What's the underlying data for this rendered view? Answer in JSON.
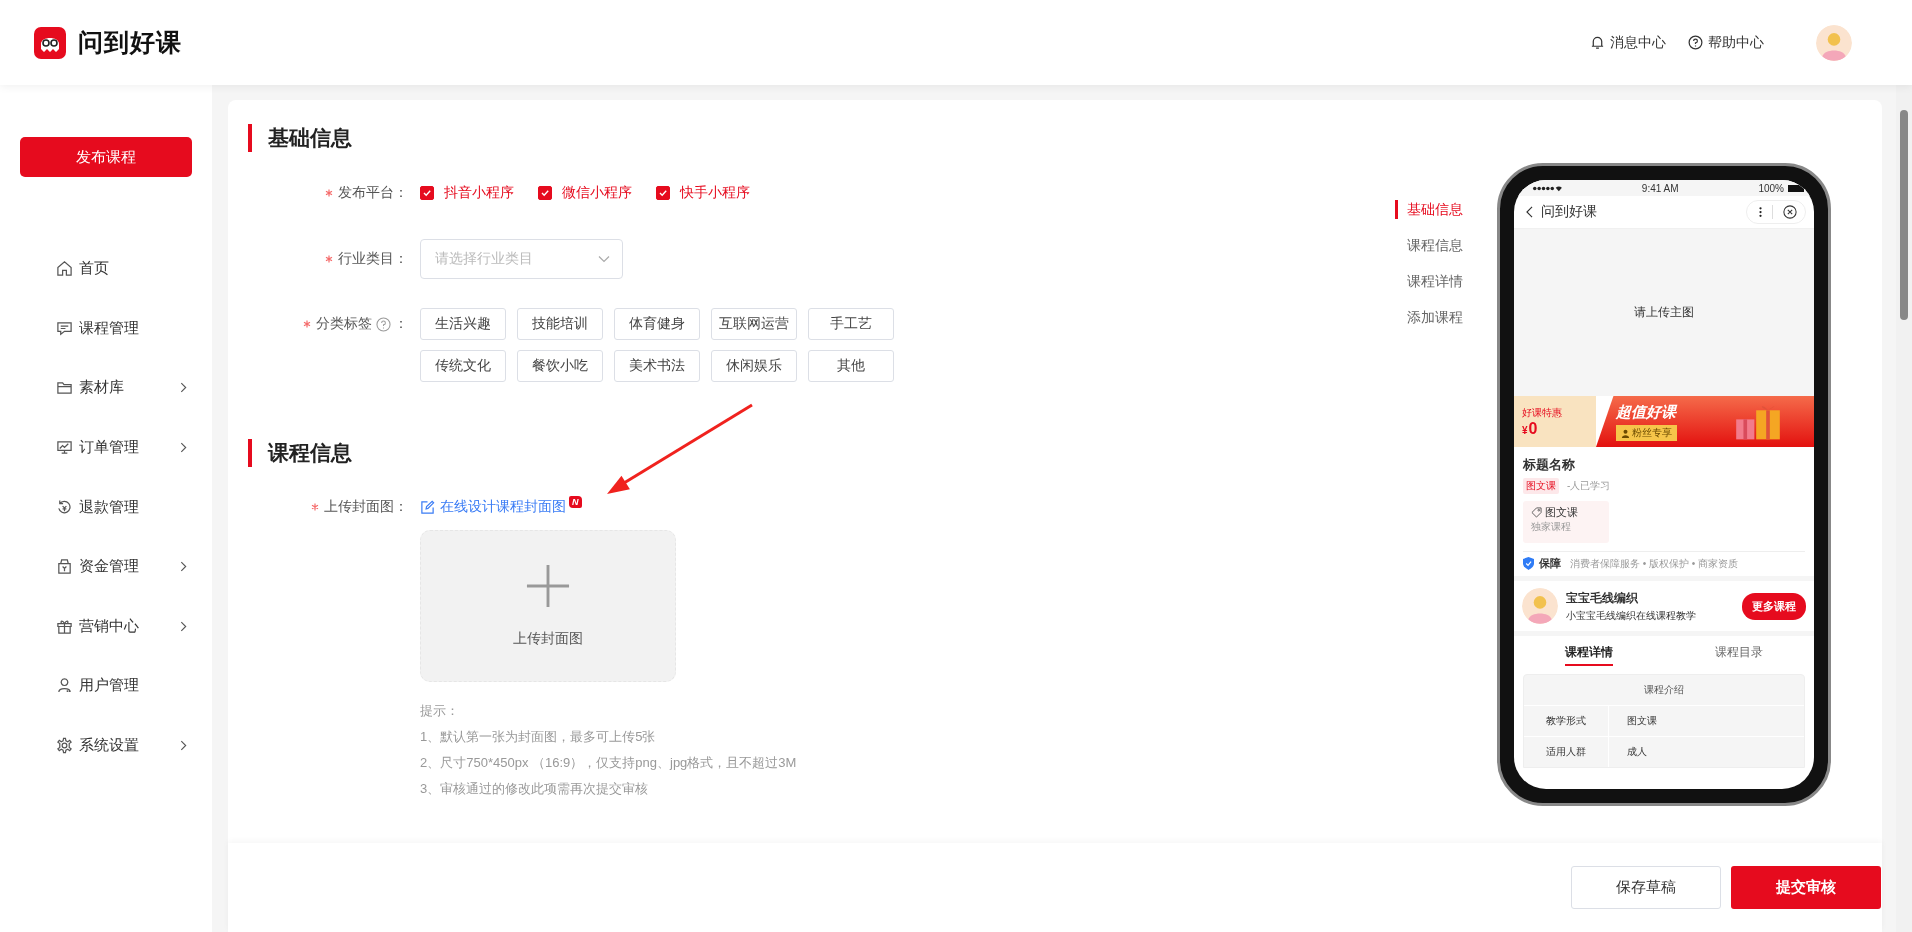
{
  "header": {
    "logo": "问到好课",
    "links": [
      {
        "kind": "bell",
        "label": "消息中心"
      },
      {
        "kind": "help",
        "label": "帮助中心"
      }
    ]
  },
  "sidebar": {
    "publish_button": "发布课程",
    "items": [
      {
        "kind": "home",
        "label": "首页",
        "expandable": false
      },
      {
        "kind": "board",
        "label": "课程管理",
        "expandable": false
      },
      {
        "kind": "folder",
        "label": "素材库",
        "expandable": true
      },
      {
        "kind": "monitor",
        "label": "订单管理",
        "expandable": true
      },
      {
        "kind": "refund",
        "label": "退款管理",
        "expandable": false
      },
      {
        "kind": "wallet",
        "label": "资金管理",
        "expandable": true
      },
      {
        "kind": "gift",
        "label": "营销中心",
        "expandable": true
      },
      {
        "kind": "user",
        "label": "用户管理",
        "expandable": false
      },
      {
        "kind": "gear",
        "label": "系统设置",
        "expandable": true
      }
    ]
  },
  "basic_info": {
    "title": "基础信息",
    "platform": {
      "label": "发布平台：",
      "required": true,
      "options": [
        {
          "label": "抖音小程序",
          "checked": true
        },
        {
          "label": "微信小程序",
          "checked": true
        },
        {
          "label": "快手小程序",
          "checked": true
        }
      ]
    },
    "industry": {
      "label": "行业类目：",
      "required": true,
      "placeholder": "请选择行业类目"
    },
    "tags": {
      "label": "分类标签",
      "colon": "：",
      "required": true,
      "options": [
        {
          "label": "生活兴趣",
          "selected": false
        },
        {
          "label": "技能培训",
          "selected": false
        },
        {
          "label": "体育健身",
          "selected": false
        },
        {
          "label": "互联网运营",
          "selected": false
        },
        {
          "label": "手工艺",
          "selected": false
        },
        {
          "label": "传统文化",
          "selected": false
        },
        {
          "label": "餐饮小吃",
          "selected": false
        },
        {
          "label": "美术书法",
          "selected": false
        },
        {
          "label": "休闲娱乐",
          "selected": false
        },
        {
          "label": "其他",
          "selected": false
        }
      ]
    }
  },
  "course_info": {
    "title": "课程信息",
    "cover": {
      "label": "上传封面图：",
      "required": true,
      "design_link": "在线设计课程封面图",
      "new_badge": "N",
      "upload_label": "上传封面图",
      "hint_title": "提示：",
      "hints": [
        "1、默认第一张为封面图，最多可上传5张",
        "2、尺寸750*450px （16:9），仅支持png、jpg格式，且不超过3M",
        "3、审核通过的修改此项需再次提交审核"
      ]
    }
  },
  "anchor_nav": [
    {
      "label": "基础信息",
      "selected": true
    },
    {
      "label": "课程信息",
      "selected": false
    },
    {
      "label": "课程详情",
      "selected": false
    },
    {
      "label": "添加课程",
      "selected": false
    }
  ],
  "preview": {
    "time": "9:41 AM",
    "battery": "100%",
    "nav_title": "问到好课",
    "image_placeholder": "请上传主图",
    "promo": {
      "label": "好课特惠",
      "currency": "¥",
      "price": "0",
      "title": "超值好课",
      "badge": "粉丝专享"
    },
    "course_title": "标题名称",
    "type_tag": "图文课",
    "learners": "-人已学习",
    "feature": {
      "title": "图文课",
      "subtitle": "独家课程"
    },
    "guarantee": {
      "label": "保障",
      "text": "消费者保障服务 • 版权保护 • 商家资质"
    },
    "author": {
      "name": "宝宝毛线编织",
      "desc": "小宝宝毛线编织在线课程教学",
      "button": "更多课程"
    },
    "tabs": [
      {
        "label": "课程详情",
        "selected": true
      },
      {
        "label": "课程目录",
        "selected": false
      }
    ],
    "intro": {
      "title": "课程介绍",
      "rows": [
        {
          "key": "教学形式",
          "value": "图文课"
        },
        {
          "key": "适用人群",
          "value": "成人"
        }
      ]
    }
  },
  "footer_buttons": [
    {
      "kind": "secondary",
      "label": "保存草稿"
    },
    {
      "kind": "primary",
      "label": "提交审核"
    }
  ]
}
